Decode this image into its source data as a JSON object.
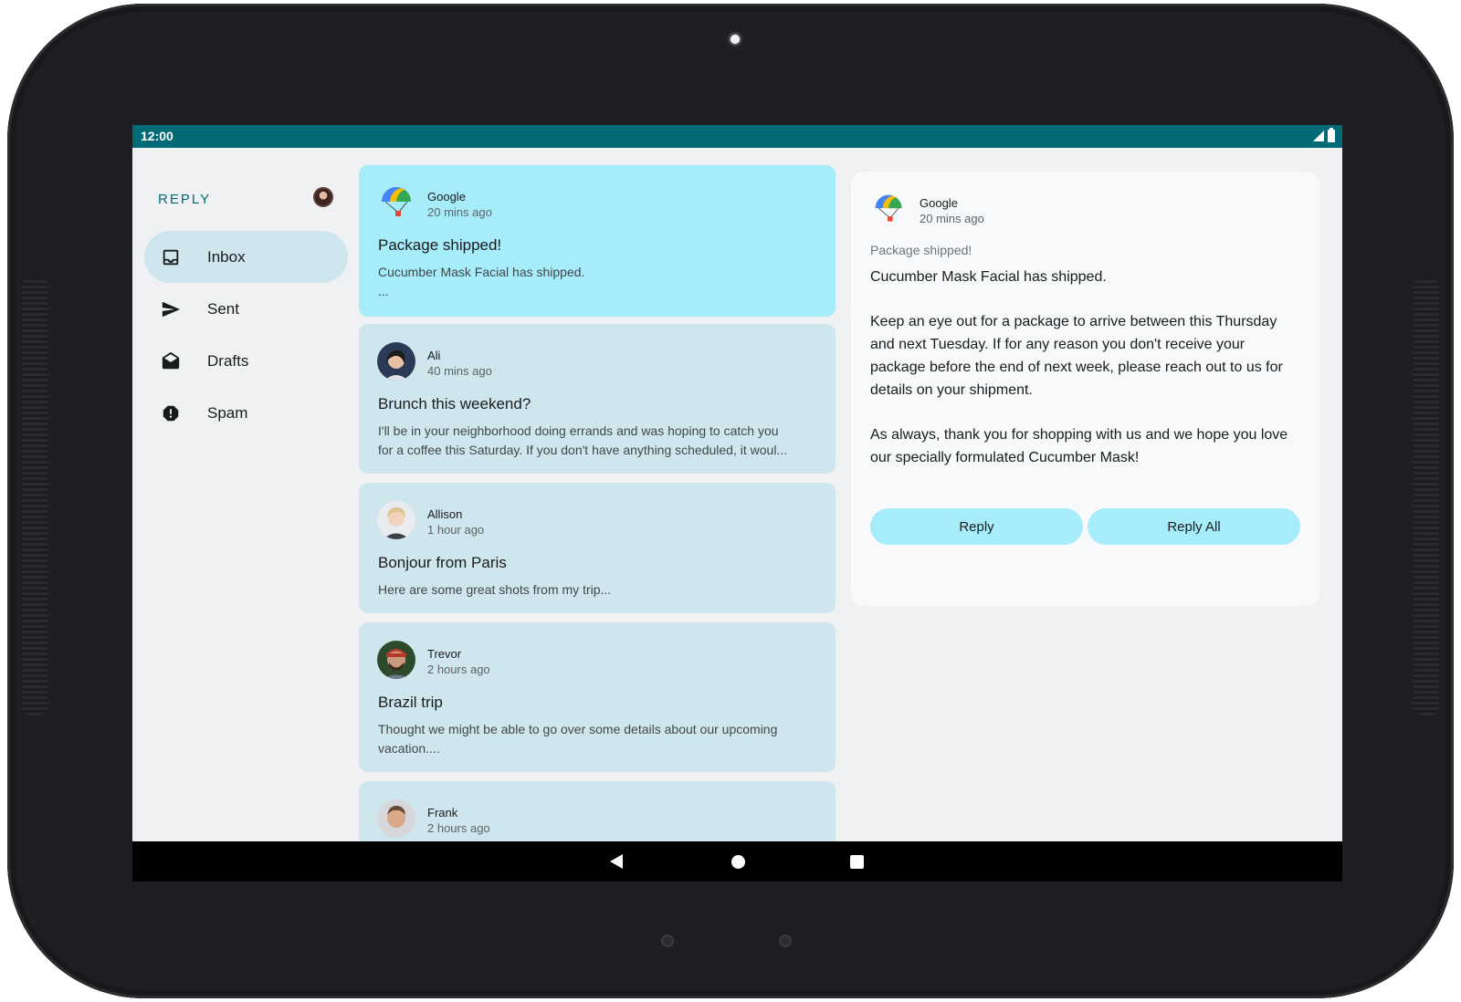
{
  "status_bar": {
    "time": "12:00"
  },
  "nav": {
    "app_title": "REPLY",
    "items": [
      {
        "label": "Inbox",
        "icon": "inbox-icon",
        "active": true
      },
      {
        "label": "Sent",
        "icon": "send-icon",
        "active": false
      },
      {
        "label": "Drafts",
        "icon": "drafts-icon",
        "active": false
      },
      {
        "label": "Spam",
        "icon": "report-icon",
        "active": false
      }
    ]
  },
  "emails": [
    {
      "sender": "Google",
      "time": "20 mins ago",
      "subject": "Package shipped!",
      "preview_line1": "Cucumber Mask Facial has shipped.",
      "preview_line2": "...",
      "avatar": "google-logo-icon",
      "selected": true
    },
    {
      "sender": "Ali",
      "time": "40 mins ago",
      "subject": "Brunch this weekend?",
      "preview_line1": "I'll be in your neighborhood doing errands and was hoping to catch you",
      "preview_line2": "for a coffee this Saturday. If you don't have anything scheduled, it woul...",
      "avatar": "ali-avatar"
    },
    {
      "sender": "Allison",
      "time": "1 hour ago",
      "subject": "Bonjour from Paris",
      "preview_line1": "Here are some great shots from my trip...",
      "preview_line2": "",
      "avatar": "allison-avatar"
    },
    {
      "sender": "Trevor",
      "time": "2 hours ago",
      "subject": "Brazil trip",
      "preview_line1": "Thought we might be able to go over some details about our upcoming",
      "preview_line2": "vacation....",
      "avatar": "trevor-avatar"
    },
    {
      "sender": "Frank",
      "time": "2 hours ago",
      "subject": "",
      "preview_line1": "",
      "preview_line2": "",
      "avatar": "frank-avatar"
    }
  ],
  "detail": {
    "sender": "Google",
    "time": "20 mins ago",
    "subject": "Package shipped!",
    "body": "Cucumber Mask Facial has shipped.\n\nKeep an eye out for a package to arrive between this Thursday and next Tuesday. If for any reason you don't receive your package before the end of next week, please reach out to us for details on your shipment.\n\nAs always, thank you for shopping with us and we hope you love our specially formulated Cucumber Mask!",
    "reply_label": "Reply",
    "reply_all_label": "Reply All"
  },
  "colors": {
    "status_bar": "#006a77",
    "selected_card": "#a7ecfb",
    "card": "#cfe6ee",
    "background": "#eff1f3",
    "accent": "#006a77"
  }
}
